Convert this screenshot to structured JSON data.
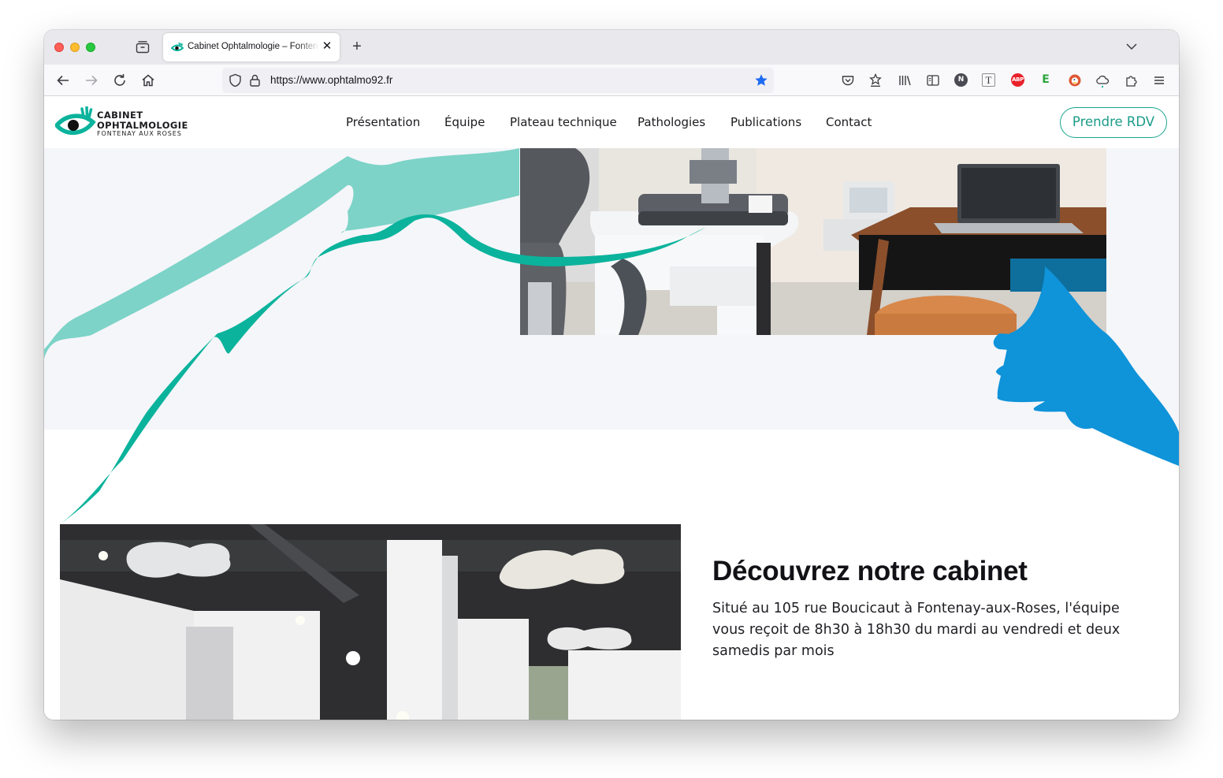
{
  "browser": {
    "tab": {
      "title": "Cabinet Ophtalmologie – Fontenay aux Roses"
    },
    "url": "https://www.ophtalmo92.fr",
    "extensions": {
      "notion_letter": "N",
      "abp_label": "ABP",
      "e_letter": "E"
    }
  },
  "site": {
    "logo": {
      "line1": "CABINET",
      "line2": "OPHTALMOLOGIE",
      "line3": "FONTENAY AUX ROSES"
    },
    "nav": [
      {
        "label": "Présentation"
      },
      {
        "label": "Équipe"
      },
      {
        "label": "Plateau technique"
      },
      {
        "label": "Pathologies"
      },
      {
        "label": "Publications"
      },
      {
        "label": "Contact"
      }
    ],
    "cta": "Prendre RDV",
    "about": {
      "title": "Découvrez notre cabinet",
      "text": "Situé au 105 rue Boucicaut à Fontenay-aux-Roses, l'équipe vous reçoit de 8h30 à 18h30 du mardi au vendredi et deux samedis par mois"
    },
    "colors": {
      "teal_light": "#7dd3c8",
      "teal": "#0bb39c",
      "blue": "#0f93d9",
      "cta": "#1aa58f"
    }
  }
}
